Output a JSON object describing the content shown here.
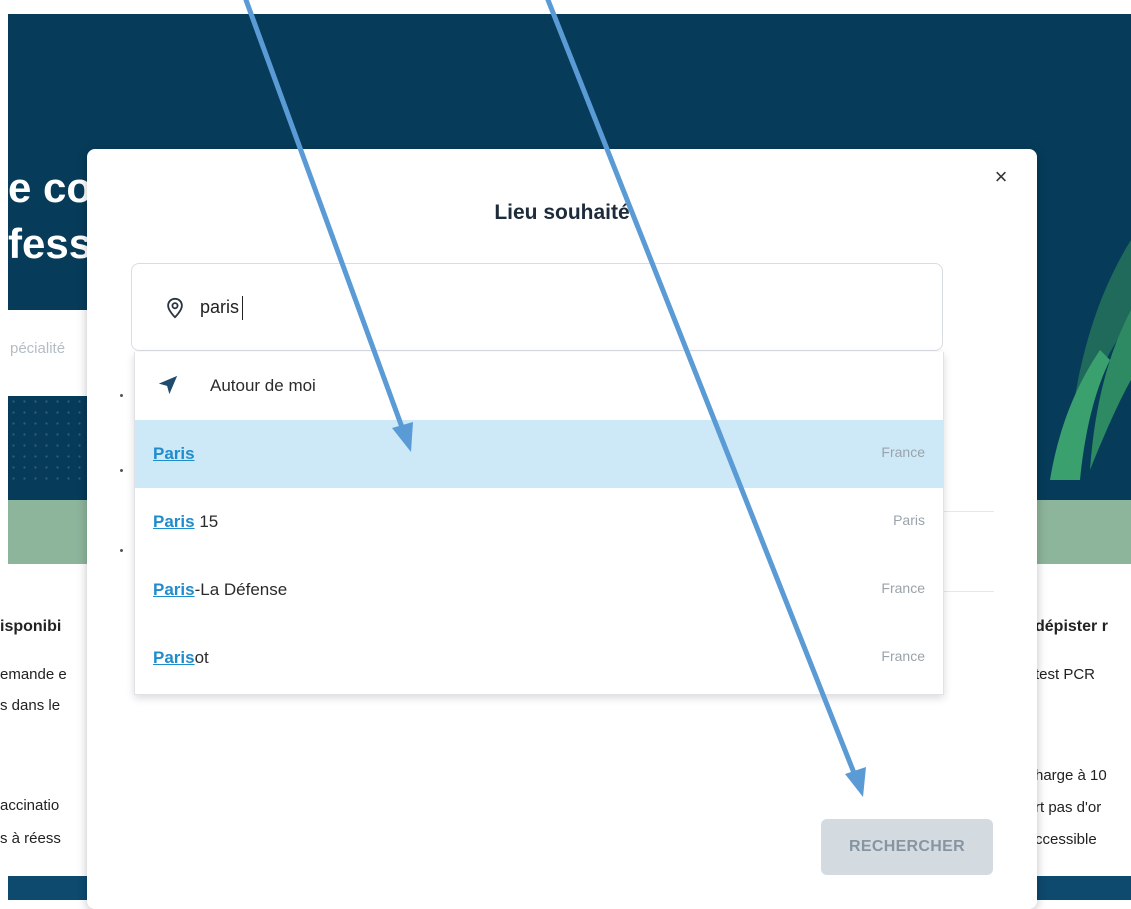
{
  "background": {
    "hero_title": "e co\nfess",
    "search_placeholder_fragment": "pécialité",
    "left_column": [
      "isponibi",
      "emande e",
      "s dans le",
      "accinatio",
      "s à réess"
    ],
    "right_column": [
      "dépister r",
      "test PCR",
      "harge à 10",
      "rt pas d'or",
      "ccessible"
    ]
  },
  "modal": {
    "title": "Lieu souhaité",
    "close_label": "×",
    "search": {
      "value": "paris",
      "icon": "location-pin-icon"
    },
    "dropdown": {
      "around_me": {
        "label": "Autour de moi",
        "icon": "navigation-arrow-icon"
      },
      "results": [
        {
          "match": "Paris",
          "rest": "",
          "region": "France",
          "active": true
        },
        {
          "match": "Paris",
          "rest": " 15",
          "region": "Paris",
          "active": false
        },
        {
          "match": "Paris",
          "rest": "-La Défense",
          "region": "France",
          "active": false
        },
        {
          "match": "Paris",
          "rest": "ot",
          "region": "France",
          "active": false
        }
      ]
    },
    "submit_label": "RECHERCHER"
  },
  "colors": {
    "hero": "#063c5a",
    "accent": "#1f8ccc",
    "active_row": "#cde9f7",
    "arrow": "#5b9bd5",
    "button_disabled": "#d3dbe1"
  }
}
